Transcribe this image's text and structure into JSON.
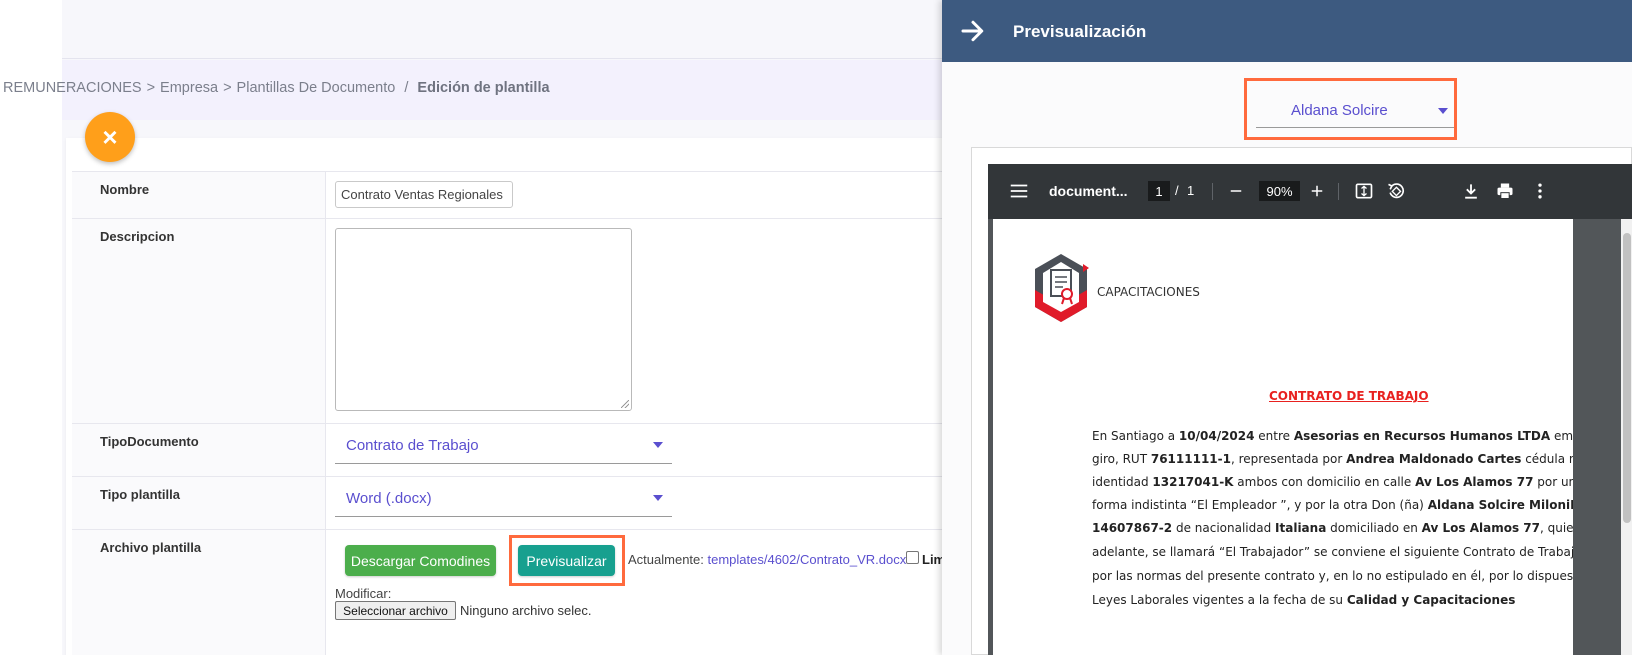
{
  "breadcrumb": {
    "items": [
      "REMUNERACIONES",
      ">",
      "Empresa",
      ">",
      "Plantillas De Documento"
    ],
    "separator": "/",
    "current": "Edición de plantilla"
  },
  "close_icon": "×",
  "form": {
    "nombre": {
      "label": "Nombre",
      "value": "Contrato Ventas Regionales"
    },
    "descripcion": {
      "label": "Descripcion",
      "value": ""
    },
    "tipo_documento": {
      "label": "TipoDocumento",
      "value": "Contrato de Trabajo"
    },
    "tipo_plantilla": {
      "label": "Tipo plantilla",
      "value": "Word (.docx)"
    },
    "archivo": {
      "label": "Archivo plantilla",
      "download_button": "Descargar Comodines",
      "preview_button": "Previsualizar",
      "currently_label": "Actualmente:",
      "currently_link": "templates/4602/Contrato_VR.docx",
      "limit_label": "Lim",
      "modify_label": "Modificar:",
      "file_button": "Seleccionar archivo",
      "file_status": "Ninguno archivo selec."
    }
  },
  "preview_panel": {
    "title": "Previsualización",
    "person_select": "Aldana Solcire",
    "pdf_viewer": {
      "doc_name": "document...",
      "page_current": "1",
      "page_separator": "/",
      "page_total": "1",
      "zoom": "90%"
    },
    "document": {
      "logo_text": "CAPACITACIONES",
      "title": "CONTRATO DE TRABAJO",
      "lines": [
        [
          "En Santiago a ",
          "10/04/2024",
          " entre  ",
          "Asesorias en Recursos Humanos LTDA",
          " empresa d"
        ],
        [
          "giro, RUT ",
          "76111111-1",
          ", representada por  ",
          "Andrea Maldonado Cartes",
          " cédula naciona"
        ],
        [
          "identidad ",
          "13217041-K",
          "  ambos con domicilio en calle ",
          "Av Los Alamos 77",
          " por una parte"
        ],
        [
          "forma indistinta “El Empleador ”, y por la otra Don (ña) ",
          "Aldana Solcire MiloniMiloni",
          ","
        ],
        [
          "",
          "14607867-2",
          " de nacionalidad ",
          "Italiana",
          " domiciliado en ",
          "Av Los Alamos 77",
          ", quien"
        ],
        [
          "adelante, se llamará “El Trabajador” se conviene el siguiente Contrato de Trabajo re"
        ],
        [
          "por las normas del presente contrato y, en lo no estipulado en él, por lo dispuesto e"
        ],
        [
          "Leyes Laborales vigentes a la fecha de su ",
          "Calidad y Capacitaciones"
        ]
      ]
    }
  },
  "colors": {
    "accent": "#5a4fcf",
    "fab": "#ff9f1a",
    "success": "#4cae4c",
    "teal": "#17a08f",
    "panel_header": "#3d5a80",
    "highlight": "#ff6a3d",
    "contract_title": "#e8211f"
  },
  "icons": {
    "close": "close-icon",
    "back": "arrow-right-icon",
    "menu": "menu-icon",
    "zoom_out": "minus-icon",
    "zoom_in": "plus-icon",
    "fit": "fit-page-icon",
    "rotate": "rotate-icon",
    "download": "download-icon",
    "print": "print-icon",
    "more": "more-vert-icon",
    "dropdown": "chevron-down-icon",
    "logo": "certificate-logo-icon"
  }
}
